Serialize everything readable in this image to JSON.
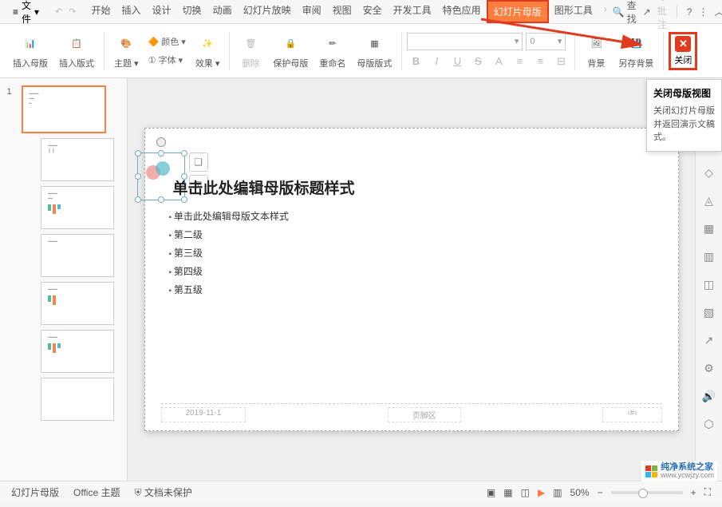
{
  "menu": {
    "file": "文件",
    "tabs": [
      "开始",
      "插入",
      "设计",
      "切换",
      "动画",
      "幻灯片放映",
      "审阅",
      "视图",
      "安全",
      "开发工具",
      "特色应用",
      "幻灯片母版",
      "图形工具"
    ],
    "active_index": 11,
    "search": "查找",
    "batch": "批注"
  },
  "ribbon": {
    "insert_master": "插入母版",
    "insert_layout": "插入版式",
    "theme": "主题",
    "color": "颜色",
    "font": "字体",
    "effects": "效果",
    "delete": "删除",
    "protect": "保护母版",
    "rename": "重命名",
    "master_layout": "母版版式",
    "bg": "背景",
    "save_bg": "另存背景",
    "close": "关闭",
    "font_size_val": "0"
  },
  "tooltip": {
    "title": "关闭母版视图",
    "desc": "关闭幻灯片母版并返回演示文稿式。"
  },
  "slide": {
    "title": "单击此处编辑母版标题样式",
    "body_l1": "单击此处编辑母版文本样式",
    "body_l2": "第二级",
    "body_l3": "第三级",
    "body_l4": "第四级",
    "body_l5": "第五级",
    "date": "2019-11-1",
    "footer": "页脚区",
    "num": "‹#›"
  },
  "thumb_num": "1",
  "status": {
    "view": "幻灯片母版",
    "theme": "Office 主题",
    "protect": "文档未保护",
    "zoom": "50%"
  },
  "watermark": {
    "line1": "纯净系统之家",
    "line2": "www.ycwjzy.com"
  },
  "icons": {
    "chevron": "▾",
    "search": "🔍",
    "share": "↗",
    "more": "⋮",
    "collapse": "︿",
    "layers": "❏",
    "group": "⊞",
    "B": "B",
    "I": "I",
    "U": "U",
    "S": "S",
    "A": "A",
    "list": "≡",
    "play": "▶",
    "fit": "⛶",
    "plus": "+",
    "minus": "−",
    "shield": "⛨"
  }
}
